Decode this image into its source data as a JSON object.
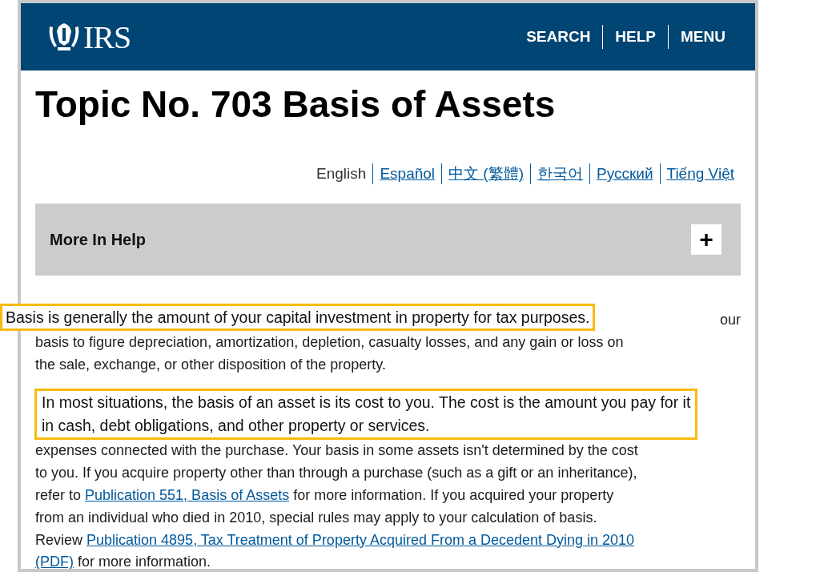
{
  "header": {
    "logo_text": "IRS",
    "nav": [
      "SEARCH",
      "HELP",
      "MENU"
    ]
  },
  "title": "Topic No. 703 Basis of Assets",
  "languages": [
    {
      "label": "English",
      "selected": true
    },
    {
      "label": "Español",
      "selected": false
    },
    {
      "label": "中文 (繁體)",
      "selected": false
    },
    {
      "label": "한국어",
      "selected": false
    },
    {
      "label": "Русский",
      "selected": false
    },
    {
      "label": "Tiếng Việt",
      "selected": false
    }
  ],
  "accordion": {
    "label": "More In Help",
    "toggle": "+",
    "expanded": false
  },
  "paragraphs": [
    {
      "cut_text": "our",
      "lines": [
        [
          {
            "text": "basis to figure depreciation, amortization, depletion, casualty losses, and any gain or loss on"
          }
        ],
        [
          {
            "text": "the sale, exchange, or other disposition of the property."
          }
        ]
      ]
    },
    {
      "lines": [
        [
          {
            "text": "expenses connected with the purchase. Your basis in some assets isn't determined by the cost"
          }
        ],
        [
          {
            "text": "to you. If you acquire property other than through a purchase (such as a gift or an inheritance),"
          }
        ],
        [
          {
            "text": "refer to "
          },
          {
            "text": "Publication 551, Basis of Assets",
            "link": true
          },
          {
            "text": " for more information. If you acquired your property"
          }
        ],
        [
          {
            "text": "from an individual who died in 2010, special rules may apply to your calculation of basis."
          }
        ],
        [
          {
            "text": "Review "
          },
          {
            "text": "Publication 4895, Tax Treatment of Property Acquired From a Decedent Dying in 2010",
            "link": true
          }
        ],
        [
          {
            "text": "(PDF)",
            "link": true
          },
          {
            "text": " for more information."
          }
        ]
      ]
    }
  ],
  "callouts": [
    {
      "lines": [
        "Basis is generally the amount of your capital investment in property for tax purposes."
      ]
    },
    {
      "lines": [
        "In most situations, the basis of an asset is its cost to you. The cost is the amount you pay for it",
        "in cash, debt obligations, and other property or services."
      ]
    }
  ]
}
